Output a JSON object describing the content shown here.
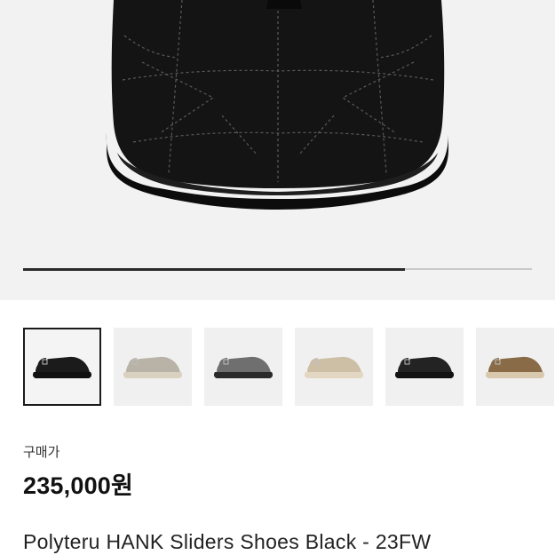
{
  "gallery": {
    "main_image": {
      "icon": "black-suede-clog-shoe",
      "upper_color": "#141414",
      "sole_color": "#0c0c0c",
      "stitch_color": "#5a5a5a"
    },
    "progress": 0.75,
    "thumbnails": [
      {
        "icon": "black-clog-thumbnail",
        "upper": "#1b1b1b",
        "sole": "#111111",
        "selected": true
      },
      {
        "icon": "grey-beige-clog-thumbnail",
        "upper": "#b8b3a6",
        "sole": "#d9d2c0",
        "selected": false
      },
      {
        "icon": "grey-clog-thumbnail",
        "upper": "#6f6f6f",
        "sole": "#2a2a2a",
        "selected": false
      },
      {
        "icon": "sand-clog-thumbnail",
        "upper": "#cdbfa6",
        "sole": "#e3d7c3",
        "selected": false
      },
      {
        "icon": "black-clog-thumbnail-2",
        "upper": "#232323",
        "sole": "#121212",
        "selected": false
      },
      {
        "icon": "brown-clog-thumbnail",
        "upper": "#8a6b48",
        "sole": "#d8c9ae",
        "selected": false
      }
    ]
  },
  "purchase": {
    "price_label": "구매가",
    "price": "235,000원"
  },
  "product": {
    "title": "Polyteru HANK Sliders Shoes Black - 23FW"
  }
}
